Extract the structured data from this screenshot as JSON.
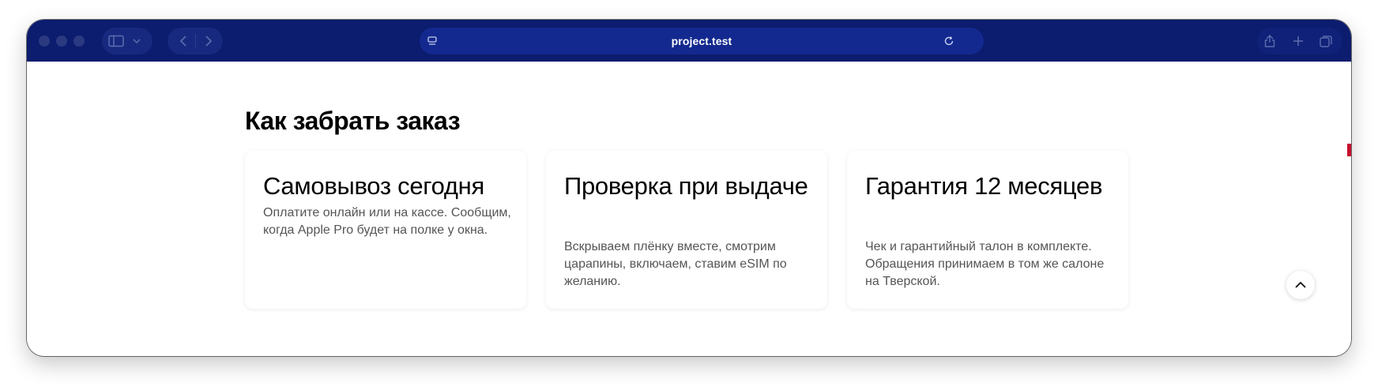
{
  "browser": {
    "url": "project.test",
    "icons": {
      "sidebar": "sidebar-icon",
      "sidebar_menu": "chevron-down-icon",
      "back": "chevron-left-icon",
      "forward": "chevron-right-icon",
      "site_settings": "page-settings-icon",
      "reload": "reload-icon",
      "share": "share-icon",
      "new_tab": "plus-icon",
      "tab_overview": "tabs-icon"
    },
    "colors": {
      "toolbar": "#0c1c6e",
      "address_bar": "#13298f"
    }
  },
  "page": {
    "heading": "Как забрать заказ",
    "cards": [
      {
        "title": "Самовывоз сегодня",
        "text": "Оплатите онлайн или на кассе. Сообщим, когда Apple Pro будет на полке у окна."
      },
      {
        "title": "Проверка при выдаче",
        "text": "Вскрываем плёнку вместе, смотрим царапины, включаем, ставим eSIM по желанию."
      },
      {
        "title": "Гарантия 12 месяцев",
        "text": "Чек и гарантийный талон в комплекте. Обращения принимаем в том же салоне на Тверской."
      }
    ],
    "scroll_top_icon": "chevron-up-icon",
    "accent_color": "#c8102e"
  }
}
